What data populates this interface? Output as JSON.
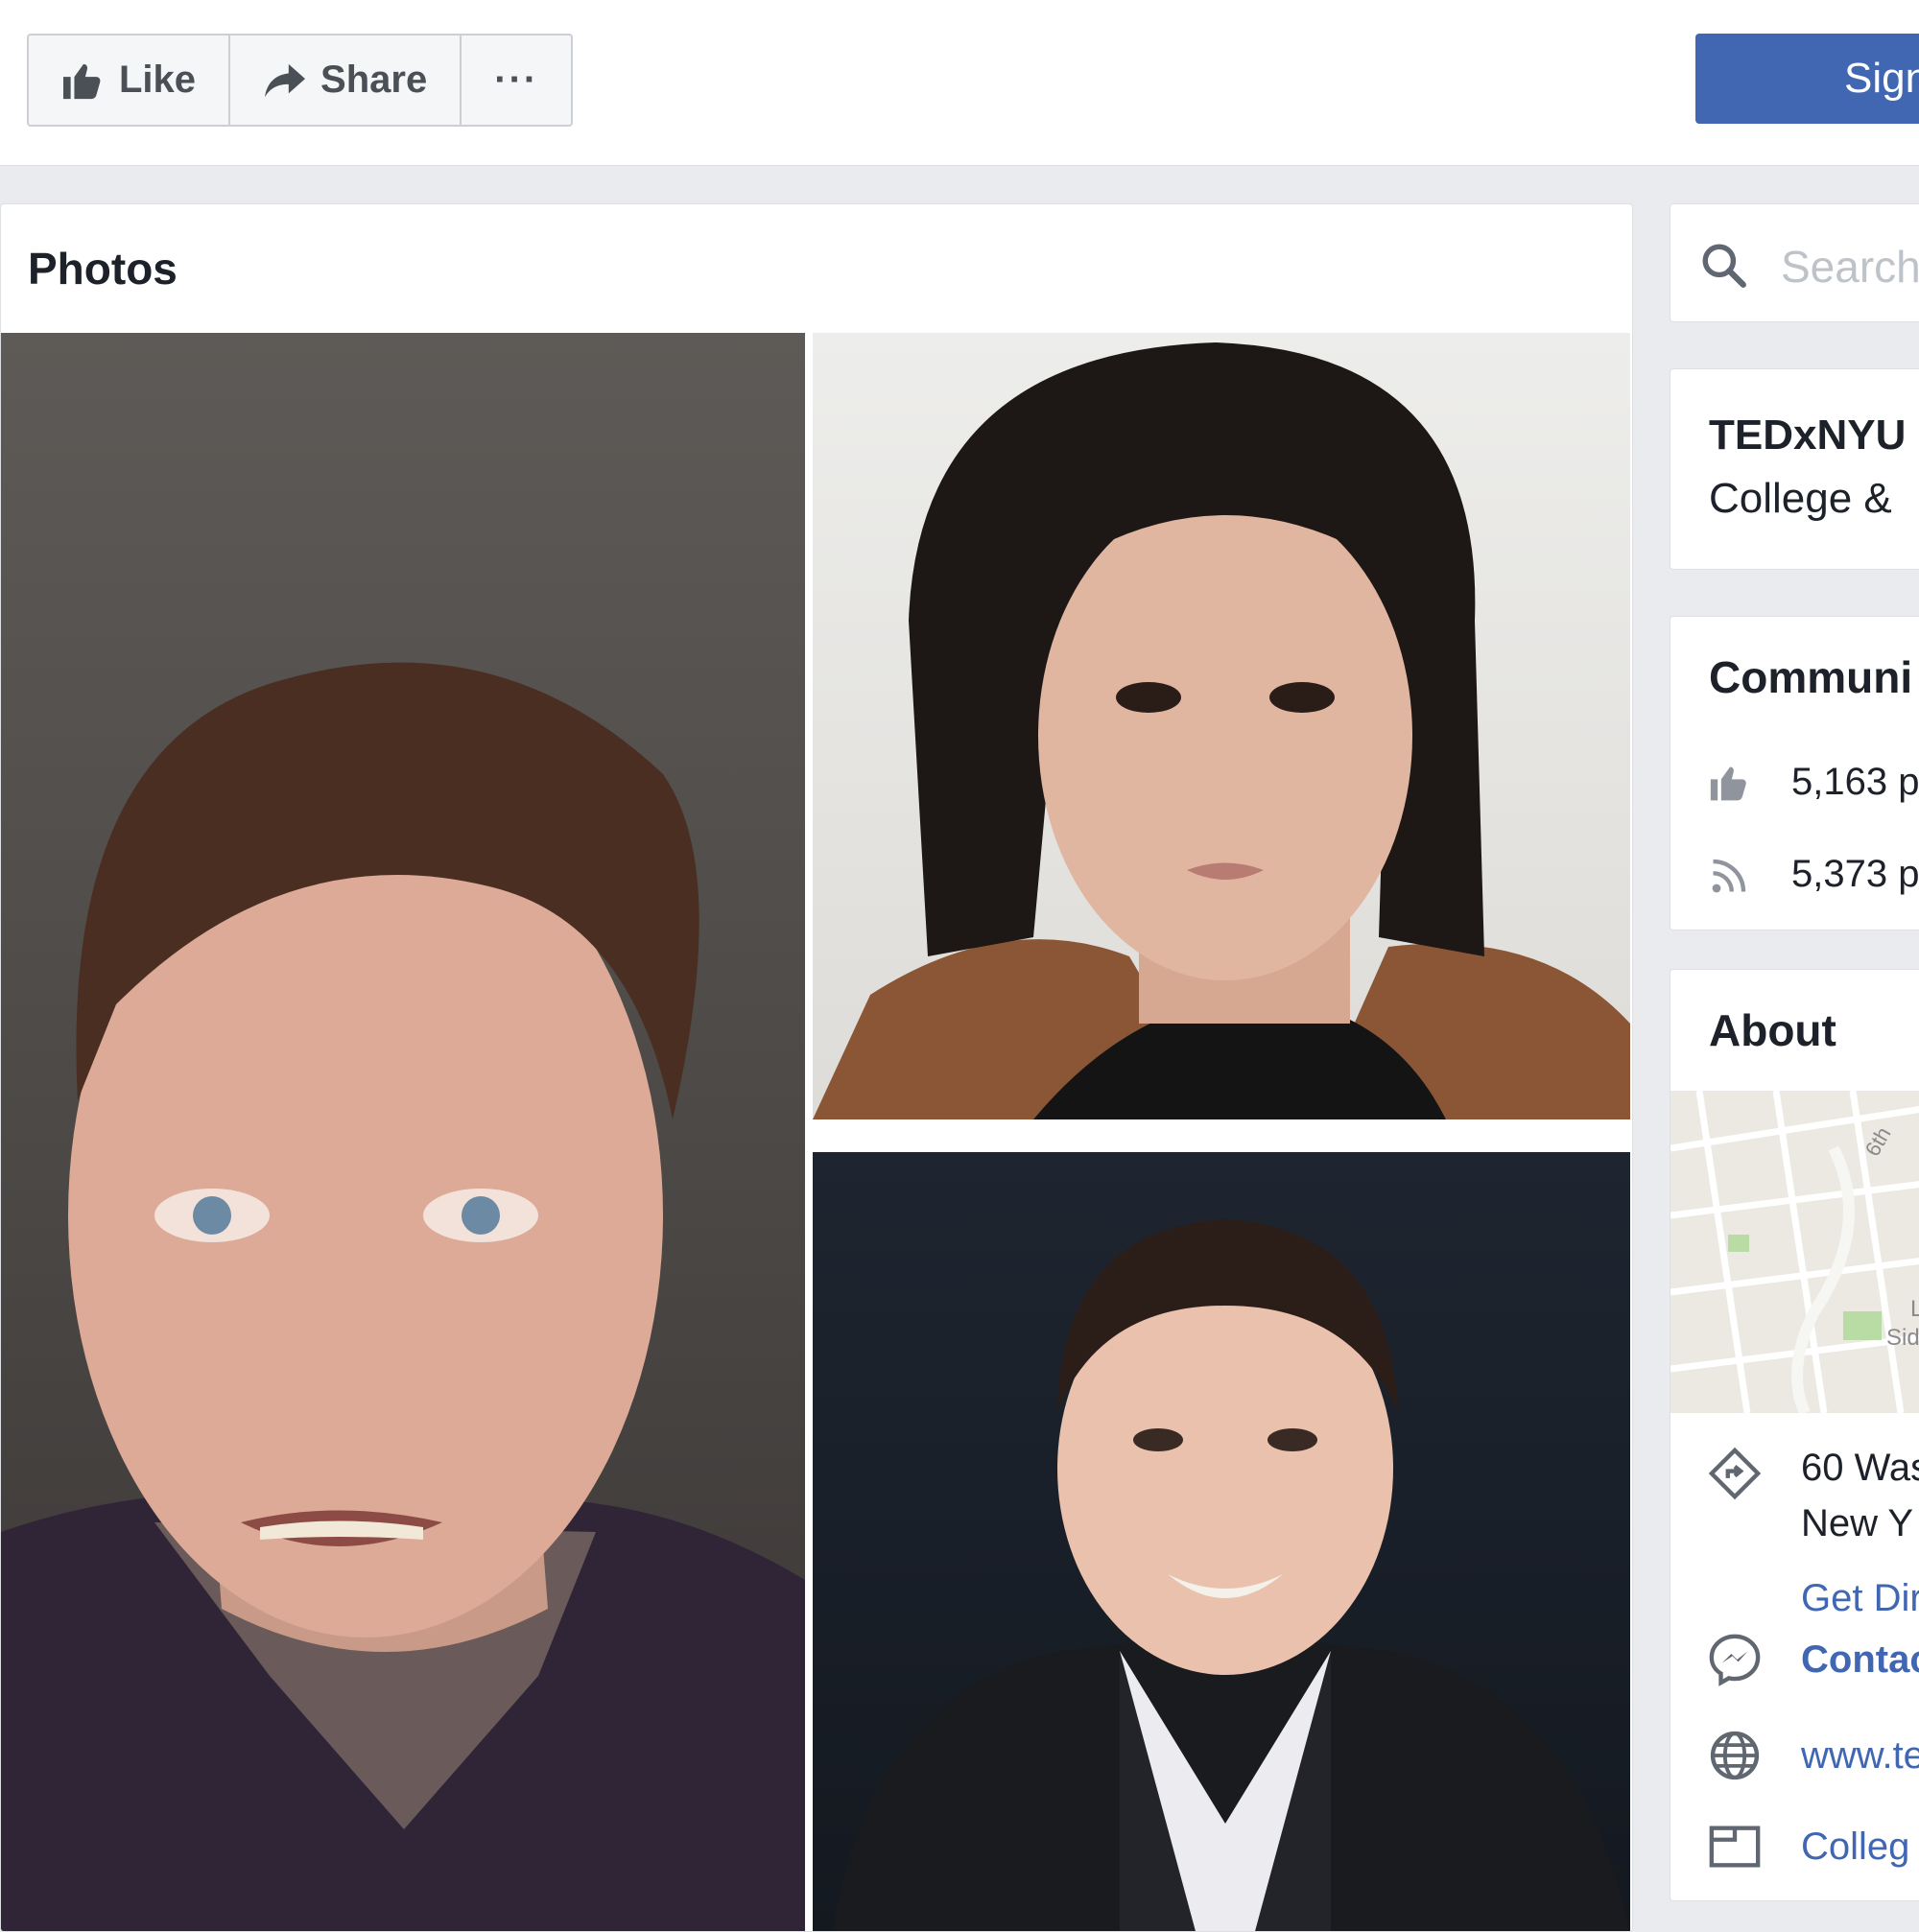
{
  "page_actions": {
    "like_label": "Like",
    "share_label": "Share",
    "more_label": "···",
    "sign_label": "Sign"
  },
  "photos": {
    "title": "Photos"
  },
  "sidebar": {
    "search_placeholder": "Search",
    "page_name": "TEDxNYU",
    "category": "College &",
    "community": {
      "title": "Communi",
      "likes": "5,163 p",
      "follows": "5,373 p"
    },
    "about": {
      "title": "About",
      "map_labels": [
        "6th",
        "L",
        "Sid"
      ],
      "address_line1": "60 Was",
      "address_line2": "New Y",
      "directions": "Get Dir",
      "contact": "Contac",
      "website": "www.te",
      "category_link": "Colleg"
    }
  },
  "colors": {
    "brand_blue": "#4267b2",
    "page_bg": "#e9ebee"
  }
}
